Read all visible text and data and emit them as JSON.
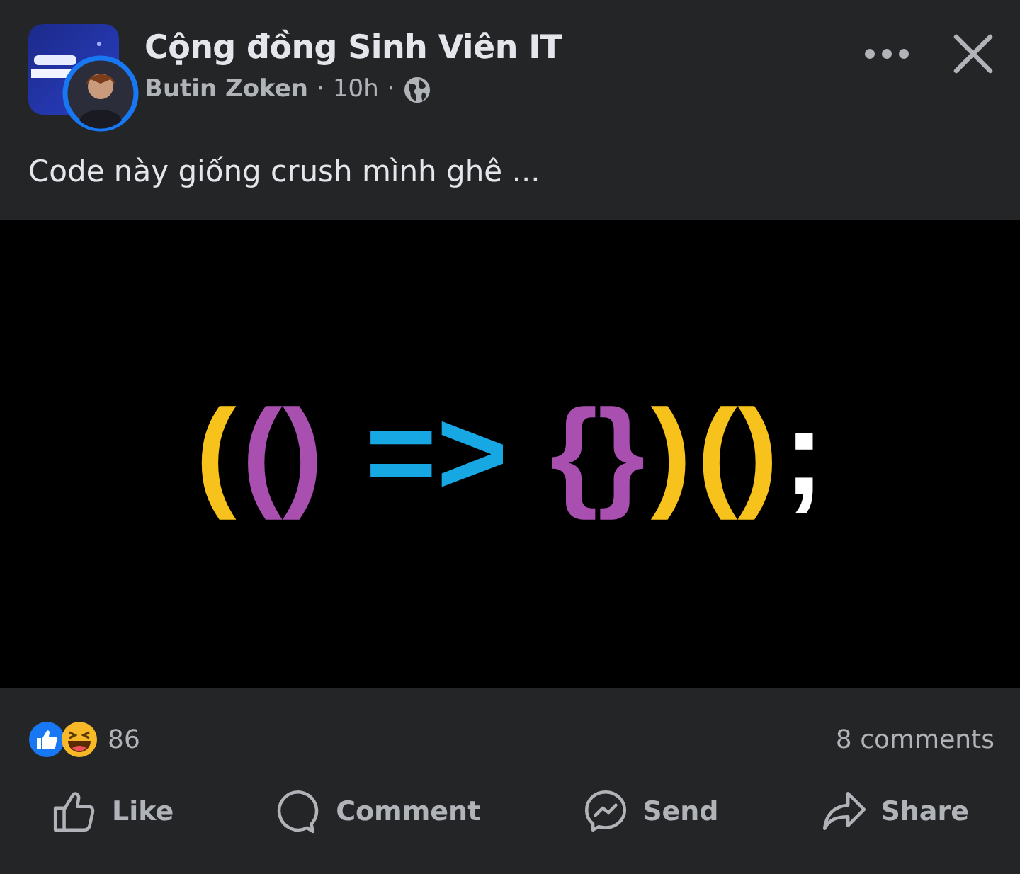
{
  "post": {
    "group": "Cộng đồng Sinh Viên IT",
    "author": "Butin Zoken",
    "separator_1": "·",
    "time": "10h",
    "separator_2": "·",
    "caption": "Code này giống crush mình ghê ..."
  },
  "image": {
    "code": [
      {
        "text": "(",
        "color": "#f7c21b"
      },
      {
        "text": "()",
        "color": "#a84fb0"
      },
      {
        "text": "=>",
        "color": "#17a8e3"
      },
      {
        "text": "{}",
        "color": "#a84fb0"
      },
      {
        "text": ")",
        "color": "#f7c21b"
      },
      {
        "text": "()",
        "color": "#f7c21b"
      },
      {
        "text": ";",
        "color": "#ffffff"
      }
    ]
  },
  "stats": {
    "reaction_count": "86",
    "comments": "8 comments"
  },
  "actions": [
    {
      "kind": "like",
      "label": "Like"
    },
    {
      "kind": "comment",
      "label": "Comment"
    },
    {
      "kind": "send",
      "label": "Send"
    },
    {
      "kind": "share",
      "label": "Share"
    }
  ]
}
